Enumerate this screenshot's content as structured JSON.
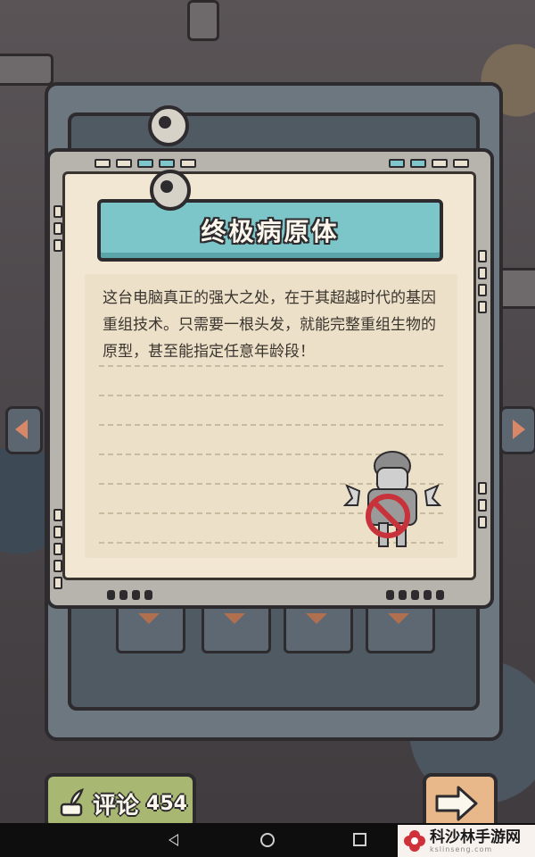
{
  "card": {
    "title": "终极病原体",
    "description": "这台电脑真正的强大之处，在于其超越时代的基因重组技术。只需要一根头发，就能完整重组生物的原型，甚至能指定任意年龄段！"
  },
  "comment_button": {
    "label": "评论",
    "count": "454"
  },
  "watermark": {
    "text": "科沙林手游网",
    "sub": "kslinseng.com"
  },
  "icons": {
    "comment": "feather-quill-icon",
    "next": "arrow-right-icon",
    "specimen": "zombie-rejected-stamp-icon"
  },
  "colors": {
    "title_banner": "#7cc5c9",
    "paper": "#f1e7d2",
    "comment_button": "#a8b873",
    "next_button": "#e8b88a",
    "stamp": "#c8323a"
  }
}
